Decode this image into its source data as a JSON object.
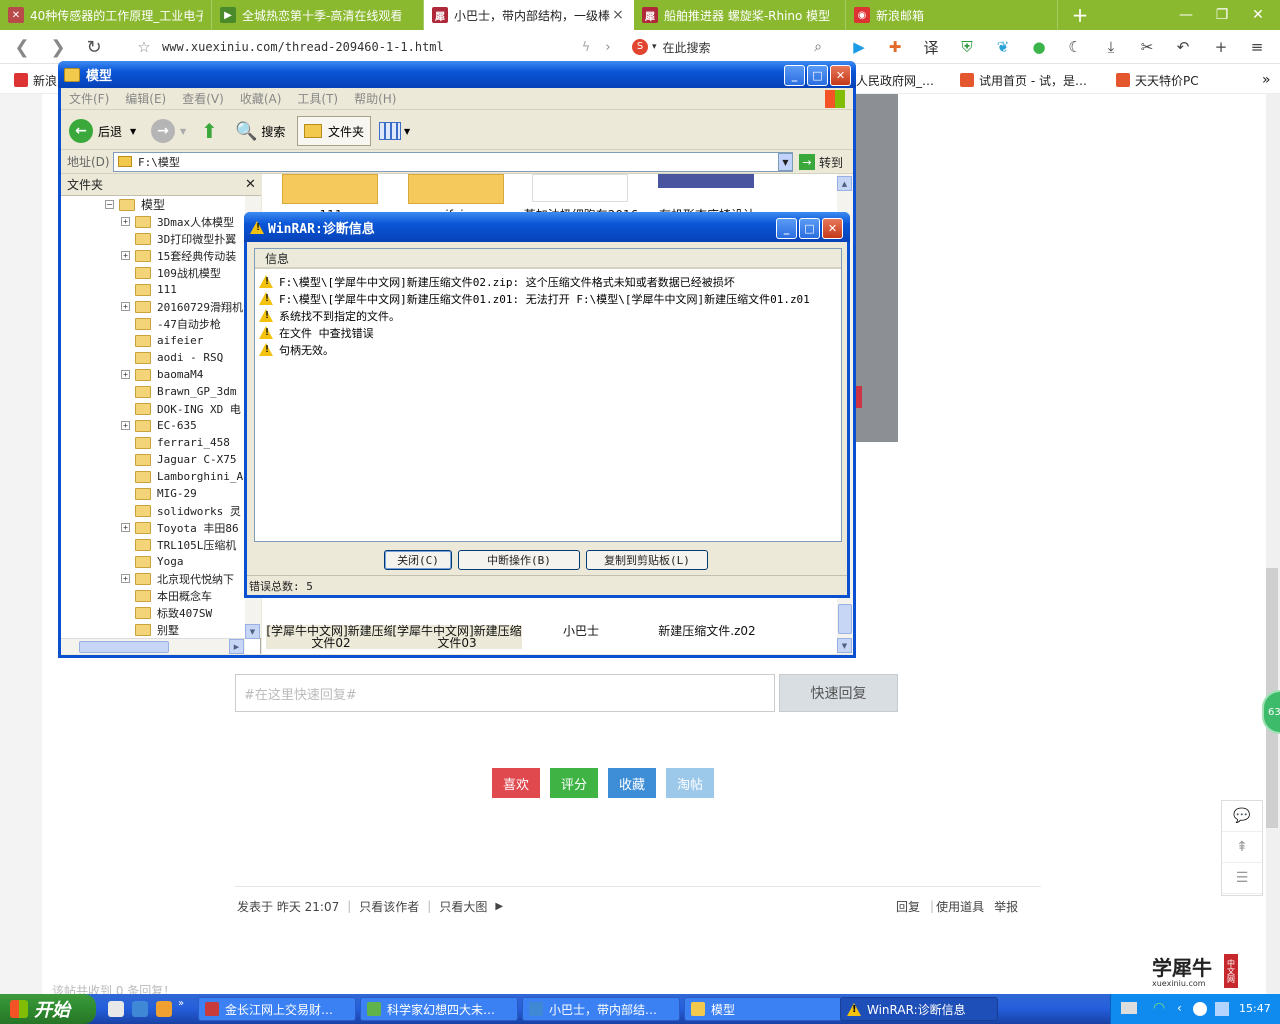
{
  "browser": {
    "tabs": [
      {
        "title": "40种传感器的工作原理_工业电子",
        "icon": "sensor-favicon",
        "color": "#b84a4a"
      },
      {
        "title": "全城热恋第十季-高清在线观看",
        "icon": "video-play-favicon",
        "color": "#4a8a2a"
      },
      {
        "title": "小巴士，带内部结构，一级棒",
        "icon": "xuexiniu-favicon",
        "color": "#b0293a"
      },
      {
        "title": "船舶推进器 螺旋桨-Rhino 模型",
        "icon": "xuexiniu-favicon",
        "color": "#b0293a"
      },
      {
        "title": "新浪邮箱",
        "icon": "sina-favicon",
        "color": "#d33"
      }
    ],
    "url": "www.xuexiniu.com/thread-209460-1-1.html",
    "search_placeholder": "在此搜索",
    "bookmarks": [
      {
        "label": "新浪"
      },
      {
        "label": "人民政府网_…"
      },
      {
        "label": "试用首页 - 试，是…"
      },
      {
        "label": "天天特价PC"
      }
    ]
  },
  "page": {
    "quick_reply_placeholder": "#在这里快速回复#",
    "quick_reply_button": "快速回复",
    "actions": [
      {
        "label": "喜欢",
        "color": "#e04a4f"
      },
      {
        "label": "评分",
        "color": "#3fb444"
      },
      {
        "label": "收藏",
        "color": "#3d8ed6"
      },
      {
        "label": "淘帖",
        "color": "#9cc8ea"
      }
    ],
    "post_meta": {
      "posted": "发表于 昨天 21:07",
      "author_only": "只看该作者",
      "big_images": "只看大图",
      "reply": "回复",
      "use_tool": "使用道具",
      "report": "举报"
    },
    "replies_count": "该帖共收到 0 条回复！",
    "badge": "63",
    "logo_text": "学犀牛",
    "logo_sub": "xuexiniu.com",
    "logo_tag": "中文网"
  },
  "explorer": {
    "title": "模型",
    "menu": [
      "文件(F)",
      "编辑(E)",
      "查看(V)",
      "收藏(A)",
      "工具(T)",
      "帮助(H)"
    ],
    "toolbar": {
      "back": "后退",
      "search": "搜索",
      "folders": "文件夹"
    },
    "address_label": "地址(D)",
    "address_value": "F:\\模型",
    "go_label": "转到",
    "tree_header": "文件夹",
    "tree_root": "模型",
    "tree_items": [
      {
        "label": "3Dmax人体模型",
        "expand": true
      },
      {
        "label": "3D打印微型扑翼",
        "expand": false
      },
      {
        "label": "15套经典传动装",
        "expand": true
      },
      {
        "label": "109战机模型",
        "expand": false
      },
      {
        "label": "111",
        "expand": false
      },
      {
        "label": "20160729滑翔机",
        "expand": true
      },
      {
        "label": "-47自动步枪",
        "expand": false
      },
      {
        "label": "aifeier",
        "expand": false
      },
      {
        "label": "aodi - RSQ",
        "expand": false
      },
      {
        "label": "baomaM4",
        "expand": true
      },
      {
        "label": "Brawn_GP_3dm",
        "expand": false
      },
      {
        "label": "DOK-ING XD 电",
        "expand": false
      },
      {
        "label": "EC-635",
        "expand": true
      },
      {
        "label": "ferrari_458",
        "expand": false
      },
      {
        "label": "Jaguar C-X75",
        "expand": false
      },
      {
        "label": "Lamborghini_A",
        "expand": false
      },
      {
        "label": "MIG-29",
        "expand": false
      },
      {
        "label": "solidworks 灵",
        "expand": false
      },
      {
        "label": "Toyota 丰田86",
        "expand": true
      },
      {
        "label": "TRL105L压缩机",
        "expand": false
      },
      {
        "label": "Yoga",
        "expand": false
      },
      {
        "label": "北京现代悦纳下",
        "expand": true
      },
      {
        "label": "本田概念车",
        "expand": false
      },
      {
        "label": "标致407SW",
        "expand": false
      },
      {
        "label": "别墅",
        "expand": false
      }
    ],
    "files_top": [
      "111",
      "aifeier",
      "蒸加油极细跑车2016",
      "有机形态座椅设计"
    ],
    "files_bottom": [
      "[学犀牛中文网]新建压缩文件02",
      "[学犀牛中文网]新建压缩文件03",
      "小巴士",
      "新建压缩文件.z02"
    ]
  },
  "winrar": {
    "title": "WinRAR:诊断信息",
    "column_header": "信息",
    "messages": [
      "F:\\模型\\[学犀牛中文网]新建压缩文件02.zip: 这个压缩文件格式未知或者数据已经被损坏",
      "F:\\模型\\[学犀牛中文网]新建压缩文件01.z01: 无法打开 F:\\模型\\[学犀牛中文网]新建压缩文件01.z01",
      "系统找不到指定的文件。",
      "在文件  中查找错误",
      "句柄无效。"
    ],
    "buttons": {
      "close": "关闭(C)",
      "abort": "中断操作(B)",
      "copy": "复制到剪贴板(L)"
    },
    "status": "错误总数: 5"
  },
  "taskbar": {
    "start": "开始",
    "tasks": [
      {
        "label": "金长江网上交易财…",
        "color": "#c93a3a"
      },
      {
        "label": "科学家幻想四大未…",
        "color": "#5fb34a"
      },
      {
        "label": "小巴士，带内部结…",
        "color": "#3f88d6"
      },
      {
        "label": "模型",
        "color": "#f2c94c"
      },
      {
        "label": "WinRAR:诊断信息",
        "color": "#f3c20f"
      }
    ],
    "clock": "15:47"
  }
}
